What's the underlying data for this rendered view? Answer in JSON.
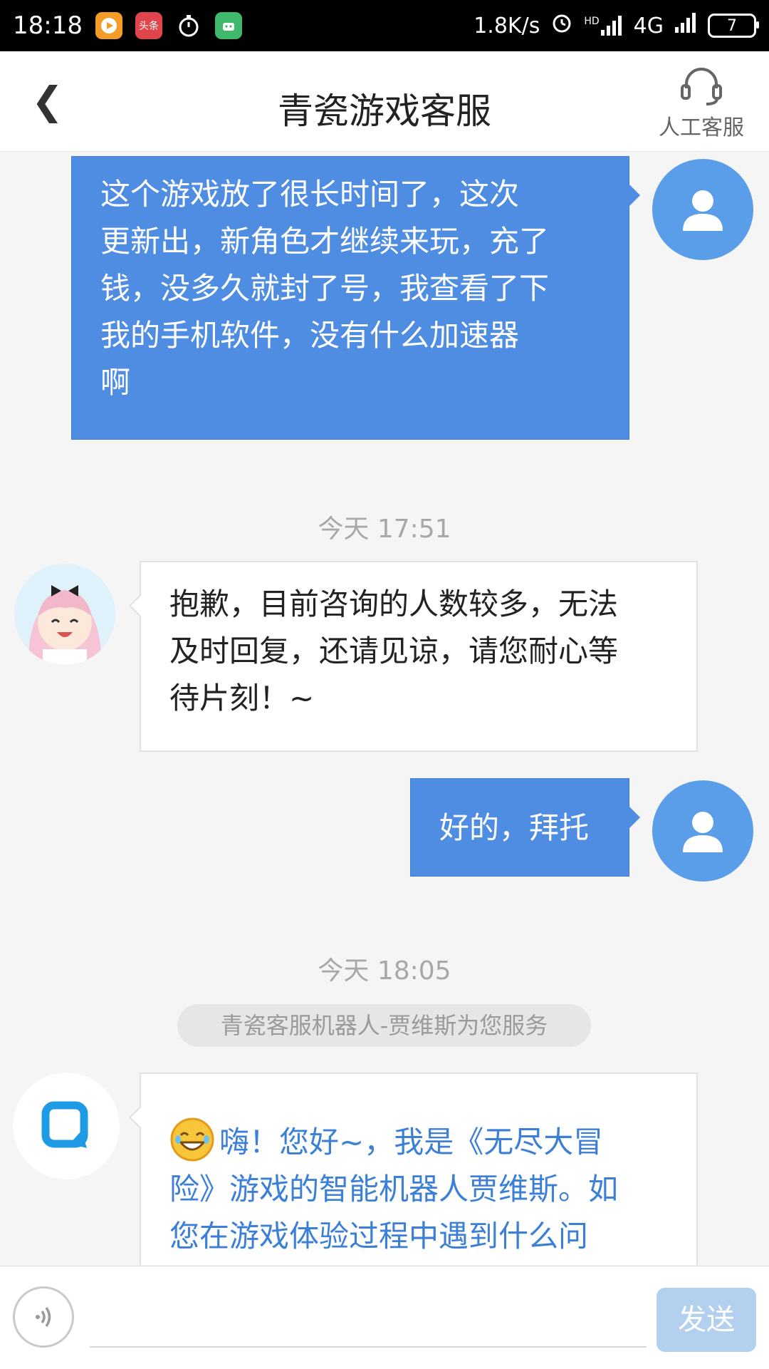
{
  "status_bar": {
    "time": "18:18",
    "app_icons": [
      "video-app-icon",
      "toutiao-app-icon",
      "stopwatch-icon",
      "android-app-icon"
    ],
    "toutiao_label": "头条",
    "net_speed": "1.8K/s",
    "network": "4G",
    "hd_label": "HD",
    "battery": "7"
  },
  "header": {
    "back_label": "❮",
    "title": "青瓷游戏客服",
    "service_label": "人工客服"
  },
  "messages": [
    {
      "sender": "user",
      "lines": [
        "这个游戏放了很长时间了，这次",
        "更新出，新角色才继续来玩，充了",
        "钱，没多久就封了号，我查看了下",
        "我的手机软件，没有什么加速器",
        "啊"
      ]
    },
    {
      "timestamp": "今天 17:51"
    },
    {
      "sender": "agent",
      "lines": [
        "抱歉，目前咨询的人数较多，无法",
        "及时回复，还请见谅，请您耐心等",
        "待片刻！~"
      ]
    },
    {
      "sender": "user",
      "lines": [
        "好的，拜托"
      ]
    },
    {
      "timestamp": "今天 18:05"
    },
    {
      "notice": "青瓷客服机器人-贾维斯为您服务"
    },
    {
      "sender": "bot",
      "lines": [
        "嗨！您好~，我是《无尽大冒",
        "险》游戏的智能机器人贾维斯。如",
        "您在游戏体验过程中遇到什么问"
      ]
    }
  ],
  "input_bar": {
    "placeholder": "",
    "send_label": "发送"
  },
  "colors": {
    "user_bubble": "#4f8de3",
    "user_avatar": "#5a9de9",
    "bot_text": "#3b7fd6",
    "send_disabled": "#b4d0ef"
  }
}
